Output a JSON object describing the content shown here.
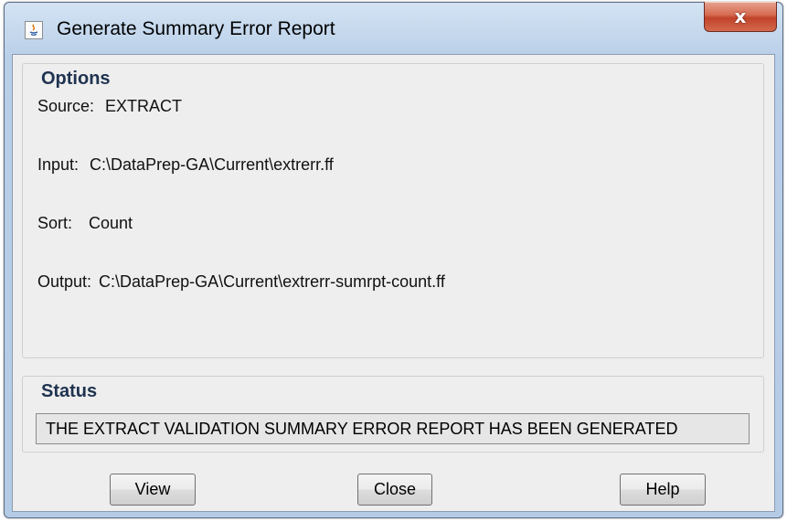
{
  "window": {
    "title": "Generate Summary Error Report",
    "close_glyph": "x",
    "icon": "java-app-icon"
  },
  "options": {
    "heading": "Options",
    "source_label": "Source:",
    "source_value": "EXTRACT",
    "input_label": "Input:",
    "input_value": "C:\\DataPrep-GA\\Current\\extrerr.ff",
    "sort_label": "Sort:",
    "sort_value": "Count",
    "output_label": "Output:",
    "output_value": "C:\\DataPrep-GA\\Current\\extrerr-sumrpt-count.ff"
  },
  "status": {
    "heading": "Status",
    "message": "THE EXTRACT VALIDATION SUMMARY ERROR REPORT HAS BEEN GENERATED"
  },
  "buttons": {
    "view": "View",
    "close": "Close",
    "help": "Help"
  },
  "colors": {
    "titlebar": "#c6d9ee",
    "close_button": "#c7442b",
    "group_heading": "#1f3350",
    "panel_background": "#eeeeee"
  }
}
